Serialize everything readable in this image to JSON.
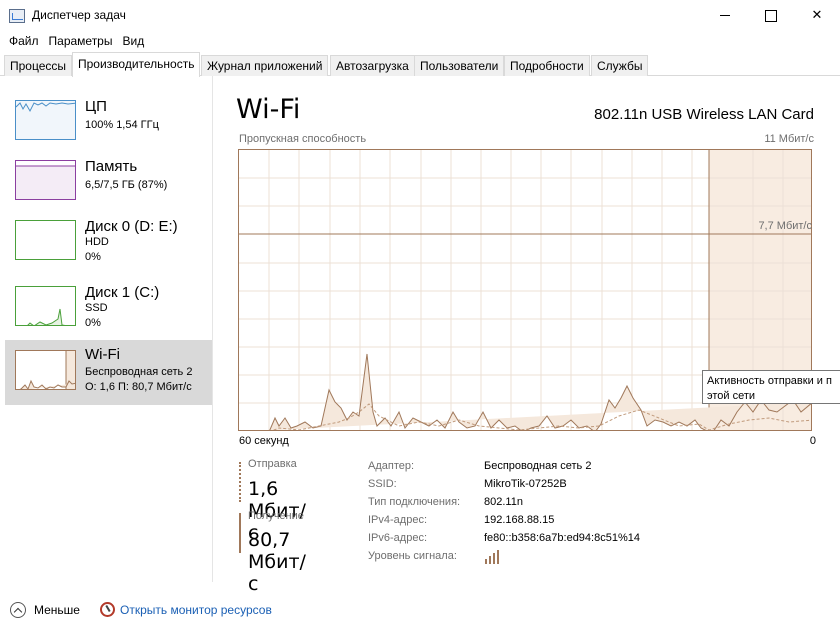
{
  "window": {
    "title": "Диспетчер задач"
  },
  "menu": [
    "Файл",
    "Параметры",
    "Вид"
  ],
  "tabs": [
    {
      "label": "Процессы"
    },
    {
      "label": "Производительность",
      "active": true
    },
    {
      "label": "Журнал приложений"
    },
    {
      "label": "Автозагрузка"
    },
    {
      "label": "Пользователи"
    },
    {
      "label": "Подробности"
    },
    {
      "label": "Службы"
    }
  ],
  "sidebar": {
    "items": [
      {
        "title": "ЦП",
        "line1": "100%  1,54 ГГц",
        "line2": "",
        "color": "#4a8fc8"
      },
      {
        "title": "Память",
        "line1": "6,5/7,5 ГБ (87%)",
        "line2": "",
        "color": "#8b3fa0"
      },
      {
        "title": "Диск 0 (D: E:)",
        "line1": "HDD",
        "line2": "0%",
        "color": "#4aa03a"
      },
      {
        "title": "Диск 1 (C:)",
        "line1": "SSD",
        "line2": "0%",
        "color": "#4aa03a"
      },
      {
        "title": "Wi-Fi",
        "line1": "Беспроводная сеть 2",
        "line2": "О: 1,6  П: 80,7 Мбит/с",
        "color": "#a0785a",
        "selected": true
      }
    ]
  },
  "main": {
    "title": "Wi-Fi",
    "adapter": "802.11n USB Wireless LAN Card",
    "graph_label": "Пропускная способность",
    "graph_max": "11 Мбит/с",
    "graph_mid": "7,7 Мбит/с",
    "axis_left": "60 секунд",
    "axis_right": "0",
    "tooltip_line1": "Активность отправки и п",
    "tooltip_line2": "этой сети",
    "send_label": "Отправка",
    "send_value": "1,6 Мбит/с",
    "recv_label": "Получение",
    "recv_value": "80,7 Мбит/с",
    "properties": [
      {
        "key": "Адаптер:",
        "value": "Беспроводная сеть 2"
      },
      {
        "key": "SSID:",
        "value": "MikroTik-07252B"
      },
      {
        "key": "Тип подключения:",
        "value": "802.11n"
      },
      {
        "key": "IPv4-адрес:",
        "value": "192.168.88.15"
      },
      {
        "key": "IPv6-адрес:",
        "value": "fe80::b358:6a7b:ed94:8c51%14"
      },
      {
        "key": "Уровень сигнала:",
        "value": ""
      }
    ],
    "accent_color": "#a0785a"
  },
  "footer": {
    "fewer_label": "Меньше",
    "monitor_label": "Открыть монитор ресурсов"
  }
}
